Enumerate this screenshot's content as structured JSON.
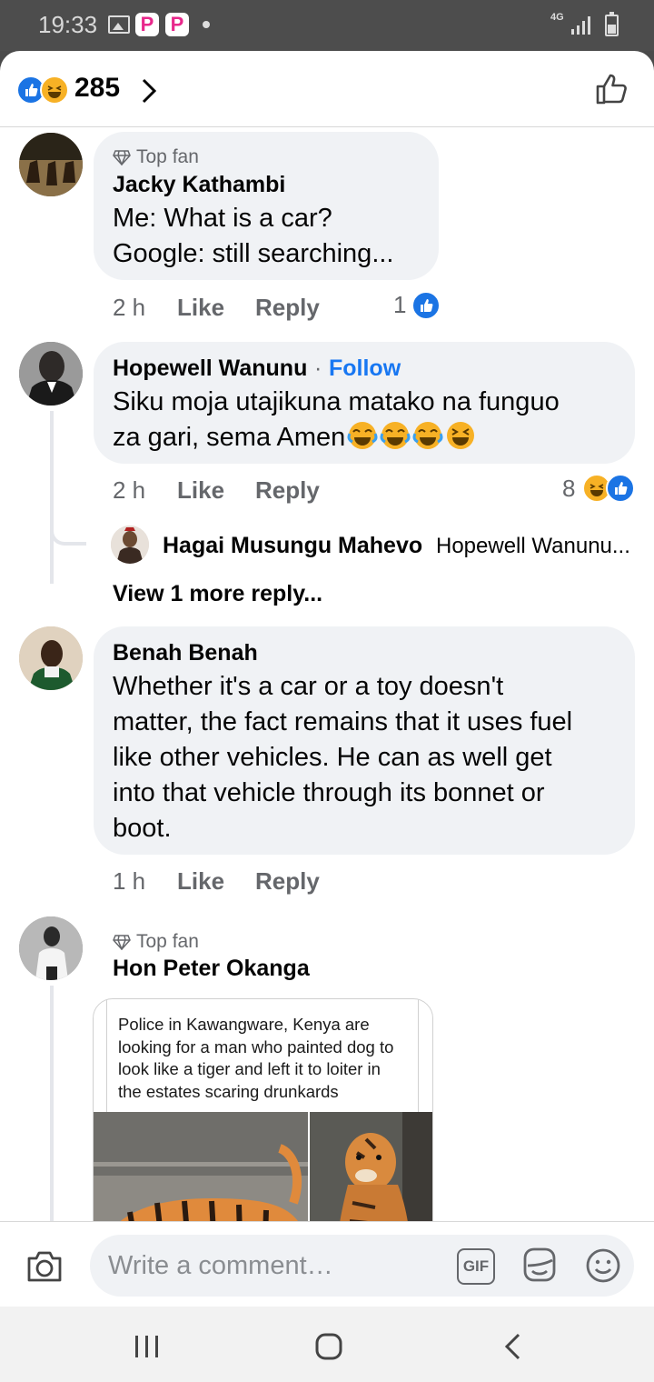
{
  "status_bar": {
    "time": "19:33",
    "network": "4G"
  },
  "reactions_header": {
    "count": "285"
  },
  "comments": [
    {
      "badge": "Top fan",
      "author": "Jacky Kathambi",
      "text_lines": [
        "Me: What is a car?",
        "Google: still searching..."
      ],
      "time": "2 h",
      "like_label": "Like",
      "reply_label": "Reply",
      "reaction_count": "1"
    },
    {
      "author": "Hopewell Wanunu",
      "separator": "·",
      "follow_label": "Follow",
      "text_lines": [
        "Siku moja utajikuna matako na funguo",
        "za gari, sema Amen"
      ],
      "time": "2 h",
      "like_label": "Like",
      "reply_label": "Reply",
      "reaction_count": "8",
      "reply_preview": {
        "author": "Hagai Musungu Mahevo",
        "text": "Hopewell Wanunu..."
      },
      "view_more_label": "View 1 more reply..."
    },
    {
      "author": "Benah Benah",
      "text_lines": [
        "Whether it's a car or a toy doesn't",
        "matter, the fact remains that it uses fuel",
        "like other vehicles. He can as well get",
        "into that vehicle through its bonnet or",
        "boot."
      ],
      "time": "1 h",
      "like_label": "Like",
      "reply_label": "Reply"
    },
    {
      "badge": "Top fan",
      "author": "Hon Peter Okanga",
      "image_caption_lines": [
        "Police in Kawangware, Kenya are",
        "looking for a man who painted dog to",
        "look like a tiger and left it to loiter in",
        "the estates scaring drunkards"
      ]
    }
  ],
  "composer": {
    "placeholder": "Write a comment…",
    "gif_label": "GIF"
  },
  "colors": {
    "accent": "#1877f2",
    "bubble": "#f0f2f5",
    "haha": "#f7b125"
  }
}
